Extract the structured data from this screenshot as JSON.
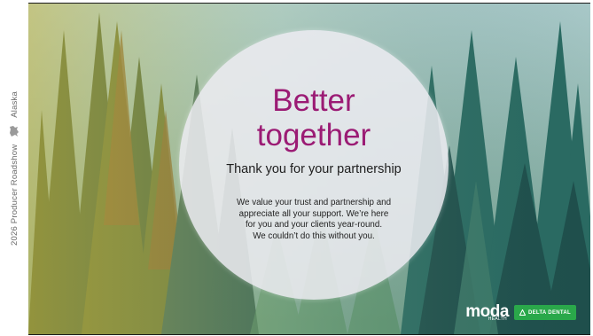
{
  "sidebar": {
    "year_label": "2026 Producer Roadshow",
    "region_label": "Alaska",
    "state_icon": "alaska-state-icon"
  },
  "slide": {
    "headline": [
      "Better",
      "together"
    ],
    "subhead": "Thank you for your partnership",
    "body_lines": [
      "We value your trust and partnership and",
      "appreciate all your support. We’re here",
      "for you and your clients year-round.",
      "We couldn’t do this without you."
    ],
    "background": "forest-photo",
    "accent_color": "#9b1b74"
  },
  "logos": {
    "moda": "moda",
    "moda_sub": "HEALTH",
    "delta": "DELTA DENTAL",
    "delta_color": "#2aa84a"
  }
}
